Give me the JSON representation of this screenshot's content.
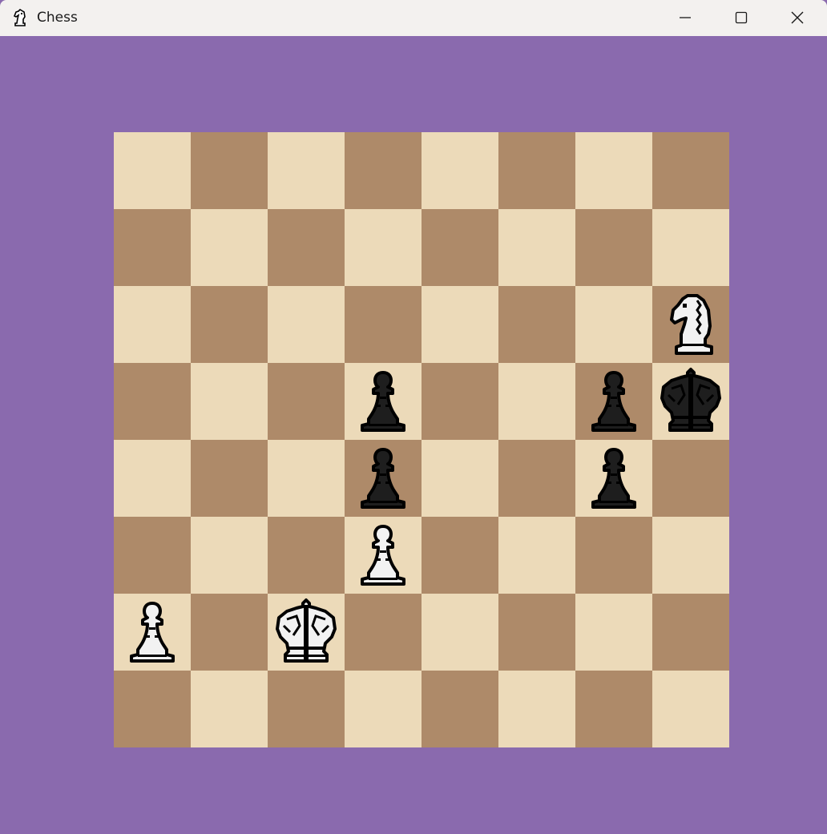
{
  "window": {
    "title": "Chess",
    "app_icon": "chess-knight-icon",
    "controls": [
      "minimize-icon",
      "maximize-icon",
      "close-icon"
    ]
  },
  "colors": {
    "background": "#8a6aae",
    "light_square": "#ecdab9",
    "dark_square": "#ae8a69",
    "white_piece_fill": "#f2f2f2",
    "black_piece_fill": "#1e1e1e",
    "outline": "#000000"
  },
  "board": {
    "files": [
      "a",
      "b",
      "c",
      "d",
      "e",
      "f",
      "g",
      "h"
    ],
    "ranks": [
      8,
      7,
      6,
      5,
      4,
      3,
      2,
      1
    ],
    "pieces": [
      {
        "square": "h6",
        "color": "white",
        "type": "knight"
      },
      {
        "square": "d5",
        "color": "black",
        "type": "pawn"
      },
      {
        "square": "g5",
        "color": "black",
        "type": "pawn"
      },
      {
        "square": "h5",
        "color": "black",
        "type": "king"
      },
      {
        "square": "d4",
        "color": "black",
        "type": "pawn"
      },
      {
        "square": "g4",
        "color": "black",
        "type": "pawn"
      },
      {
        "square": "d3",
        "color": "white",
        "type": "pawn"
      },
      {
        "square": "a2",
        "color": "white",
        "type": "pawn"
      },
      {
        "square": "c2",
        "color": "white",
        "type": "king"
      }
    ]
  }
}
